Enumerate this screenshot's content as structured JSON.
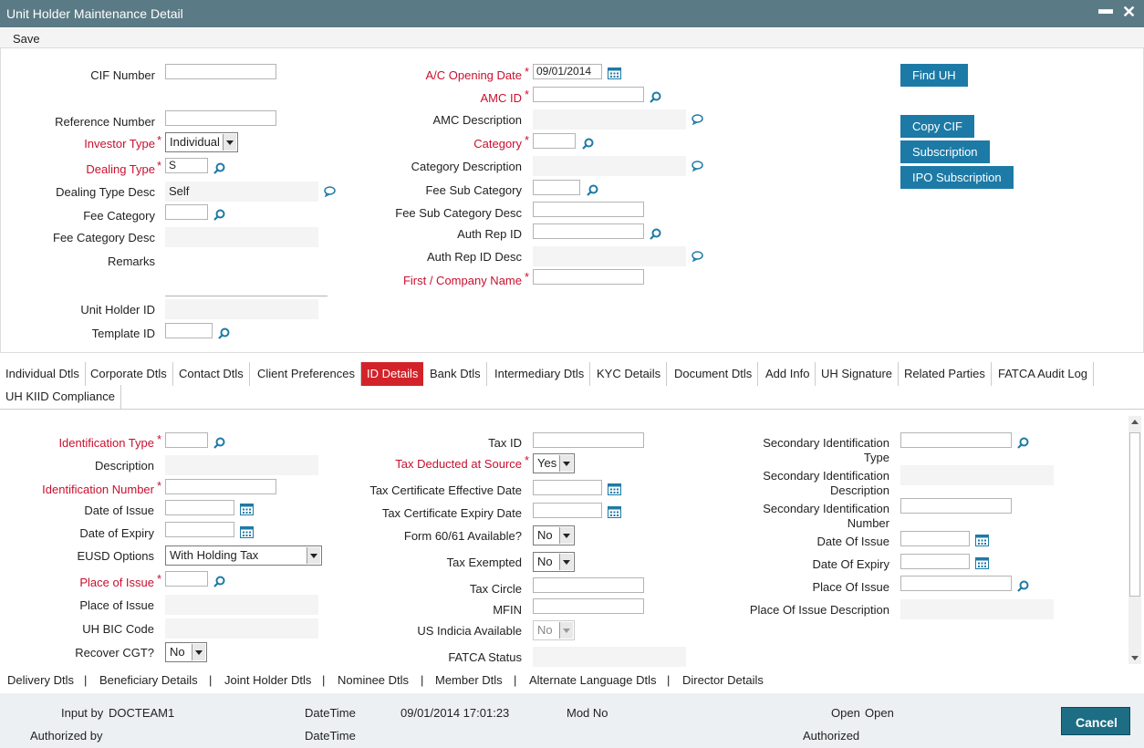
{
  "window": {
    "title": "Unit Holder Maintenance Detail",
    "minimize": "▬",
    "close": "✕"
  },
  "toolbar": {
    "save_label": "Save"
  },
  "header": {
    "cif_number": "CIF Number",
    "reference_number": "Reference Number",
    "investor_type": "Investor Type",
    "investor_type_value": "Individual",
    "dealing_type": "Dealing Type",
    "dealing_type_value": "S",
    "dealing_type_desc": "Dealing Type Desc",
    "dealing_type_desc_value": "Self",
    "fee_category": "Fee Category",
    "fee_category_desc": "Fee Category Desc",
    "remarks": "Remarks",
    "unit_holder_id": "Unit Holder ID",
    "template_id": "Template ID",
    "ac_opening_date": "A/C Opening Date",
    "ac_opening_date_value": "09/01/2014",
    "amc_id": "AMC ID",
    "amc_description": "AMC Description",
    "category": "Category",
    "category_description": "Category Description",
    "fee_sub_category": "Fee Sub Category",
    "fee_sub_category_desc": "Fee Sub Category Desc",
    "auth_rep_id": "Auth Rep ID",
    "auth_rep_id_desc": "Auth Rep ID Desc",
    "first_company_name": "First / Company Name"
  },
  "actions": {
    "find_uh": "Find UH",
    "copy_cif": "Copy CIF",
    "subscription": "Subscription",
    "ipo_subscription": "IPO Subscription"
  },
  "tabs": [
    "Individual Dtls",
    "Corporate Dtls",
    "Contact Dtls",
    "Client Preferences",
    "ID Details",
    "Bank Dtls",
    "Intermediary Dtls",
    "KYC Details",
    "Document Dtls",
    "Add Info",
    "UH Signature",
    "Related Parties",
    "FATCA Audit Log",
    "UH KIID Compliance"
  ],
  "active_tab": "ID Details",
  "id_details": {
    "identification_type": "Identification Type",
    "description": "Description",
    "identification_number": "Identification Number",
    "date_of_issue": "Date of Issue",
    "date_of_expiry": "Date of Expiry",
    "eusd_options": "EUSD Options",
    "eusd_options_value": "With Holding Tax",
    "place_of_issue": "Place of Issue",
    "place_of_issue_desc": "Place of Issue",
    "uh_bic_code": "UH BIC Code",
    "recover_cgt": "Recover CGT?",
    "recover_cgt_value": "No",
    "tax_id": "Tax ID",
    "tax_deducted_at_source": "Tax Deducted at Source",
    "tax_deducted_at_source_value": "Yes",
    "tax_cert_effective_date": "Tax Certificate Effective Date",
    "tax_cert_expiry_date": "Tax Certificate Expiry Date",
    "form_6061_available": "Form 60/61 Available?",
    "form_6061_available_value": "No",
    "tax_exempted": "Tax Exempted",
    "tax_exempted_value": "No",
    "tax_circle": "Tax Circle",
    "mfin": "MFIN",
    "us_indicia_available": "US Indicia Available",
    "us_indicia_available_value": "No",
    "fatca_status": "FATCA Status",
    "secondary_id_type_1": "Secondary Identification",
    "secondary_id_type_2": "Type",
    "secondary_id_desc_1": "Secondary Identification",
    "secondary_id_desc_2": "Description",
    "secondary_id_number_1": "Secondary Identification",
    "secondary_id_number_2": "Number",
    "sec_date_of_issue": "Date Of Issue",
    "sec_date_of_expiry": "Date Of Expiry",
    "sec_place_of_issue": "Place Of Issue",
    "sec_place_of_issue_desc": "Place Of Issue Description"
  },
  "bottom_links": [
    "Delivery Dtls",
    "Beneficiary Details",
    "Joint Holder Dtls",
    "Nominee Dtls",
    "Member Dtls",
    "Alternate Language Dtls",
    "Director Details"
  ],
  "separator": "|",
  "footer": {
    "input_by_label": "Input by",
    "input_by_value": "DOCTEAM1",
    "authorized_by_label": "Authorized by",
    "datetime_label": "DateTime",
    "datetime_value": "09/01/2014 17:01:23",
    "datetime2_label": "DateTime",
    "mod_no_label": "Mod No",
    "open_label": "Open",
    "open_value": "Open",
    "authorized_label": "Authorized",
    "cancel_label": "Cancel"
  },
  "colors": {
    "title_bar": "#5a7a85",
    "button": "#1d7aa6",
    "active_tab": "#d2232a",
    "required": "#c8102e",
    "cancel": "#1d6e84"
  }
}
